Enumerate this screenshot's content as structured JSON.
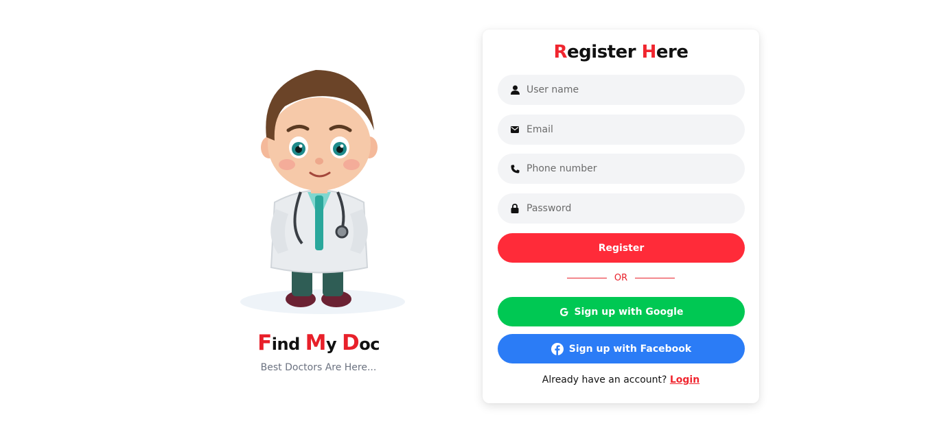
{
  "brand": {
    "title_parts": [
      "F",
      "ind ",
      "M",
      "y ",
      "D",
      "oc"
    ],
    "subtitle": "Best Doctors Are Here...",
    "illustration": "doctor-cartoon-illustration"
  },
  "form": {
    "title_parts": [
      "R",
      "egister ",
      "H",
      "ere"
    ],
    "fields": [
      {
        "name": "username",
        "placeholder": "User name",
        "icon": "user-icon",
        "type": "text"
      },
      {
        "name": "email",
        "placeholder": "Email",
        "icon": "envelope-icon",
        "type": "email"
      },
      {
        "name": "phone",
        "placeholder": "Phone number",
        "icon": "phone-icon",
        "type": "tel"
      },
      {
        "name": "password",
        "placeholder": "Password",
        "icon": "lock-icon",
        "type": "password"
      }
    ],
    "register_label": "Register",
    "or_label": "OR",
    "google_label": "Sign up with Google",
    "facebook_label": "Sign up with Facebook",
    "login_prompt": "Already have an account?",
    "login_link": "Login"
  },
  "colors": {
    "accent_red": "#ff2b39",
    "google_green": "#00c853",
    "facebook_blue": "#2b7cf6",
    "field_bg": "#f3f4f6"
  }
}
